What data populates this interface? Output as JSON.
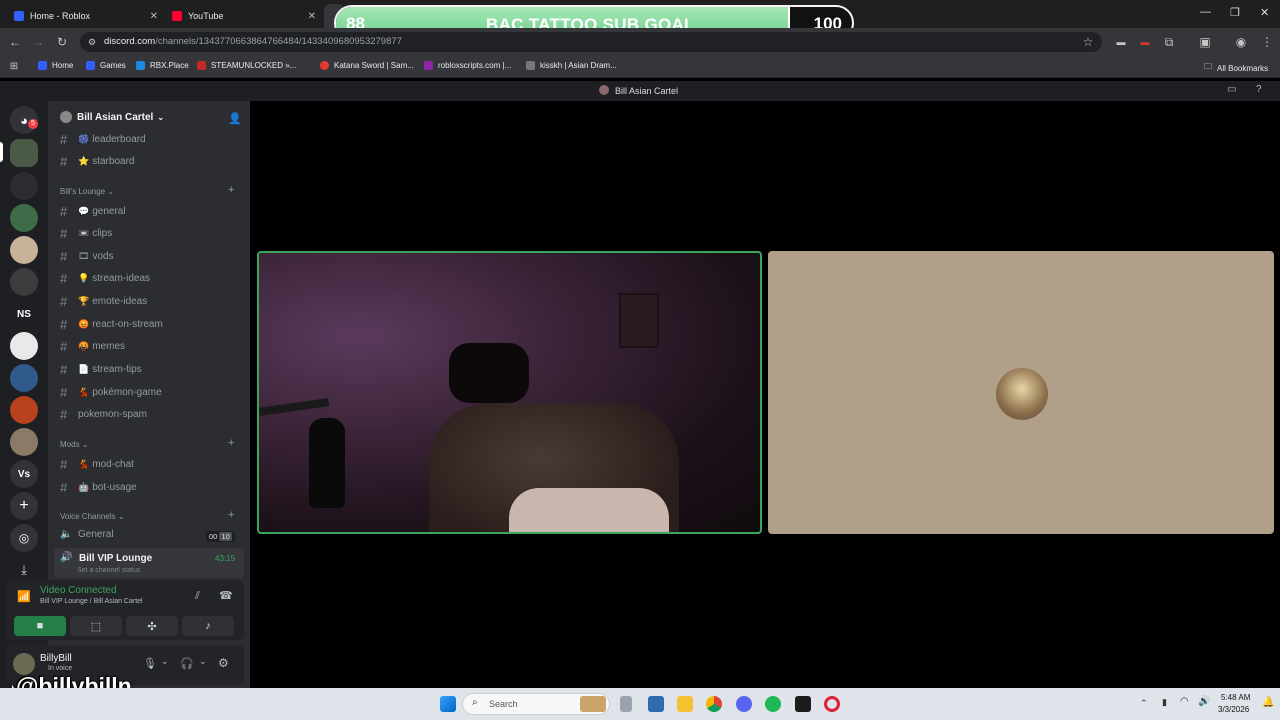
{
  "browser": {
    "tabs": [
      {
        "title": "Home - Roblox",
        "favicon_color": "#335fff"
      },
      {
        "title": "YouTube",
        "favicon_color": "#ff0033"
      },
      {
        "title": "",
        "favicon_color": "#5865f2"
      }
    ],
    "url_host": "discord.com",
    "url_path": "/channels/1343770663864766484/1433409680953279877",
    "bookmarks": [
      "Home",
      "Games",
      "RBX.Place",
      "STEAMUNLOCKED »...",
      "Katana Sword | Sam...",
      "robloxscripts.com |...",
      "kisskh | Asian Dram..."
    ],
    "all_bookmarks": "All Bookmarks"
  },
  "sub_goal": {
    "current": "88",
    "title": "BAC TATTOO SUB GOAL",
    "target": "100",
    "progress": 0.88
  },
  "discord": {
    "window_title": "Bill Asian Cartel",
    "server_name": "Bill Asian Cartel",
    "rail_badge": "5",
    "rail_texts": [
      "NS",
      "Vs"
    ],
    "channels_top": [
      {
        "emoji": "🎆",
        "name": "leaderboard"
      },
      {
        "emoji": "⭐",
        "name": "starboard"
      }
    ],
    "category_lounge": "Bill's Lounge",
    "channels_lounge": [
      {
        "emoji": "💬",
        "name": "general"
      },
      {
        "emoji": "📼",
        "name": "clips"
      },
      {
        "emoji": "🎞",
        "name": "vods"
      },
      {
        "emoji": "💡",
        "name": "stream-ideas"
      },
      {
        "emoji": "🏆",
        "name": "emote-ideas"
      },
      {
        "emoji": "😡",
        "name": "react-on-stream"
      },
      {
        "emoji": "🤬",
        "name": "memes"
      },
      {
        "emoji": "📄",
        "name": "stream-tips"
      },
      {
        "emoji": "💃",
        "name": "pokémon-game"
      },
      {
        "emoji": "",
        "name": "pokemon-spam"
      }
    ],
    "category_mods": "Mods",
    "channels_mods": [
      {
        "emoji": "💃",
        "name": "mod-chat"
      },
      {
        "emoji": "🤖",
        "name": "bot-usage"
      }
    ],
    "category_voice": "Voice Channels",
    "voice_general": {
      "name": "General",
      "count_a": "00",
      "count_b": "10"
    },
    "voice_vip": {
      "name": "Bill VIP Lounge",
      "timer": "43:15",
      "status_placeholder": "Set a channel status"
    },
    "voice_panel": {
      "status": "Video Connected",
      "location": "Bill VIP Lounge / Bill Asian Cartel"
    },
    "user": {
      "name": "BillyBill",
      "status": "In voice"
    }
  },
  "watermark": "@billybilln",
  "taskbar": {
    "search_placeholder": "Search",
    "time": "5:48 AM",
    "date": "3/3/2026"
  },
  "colors": {
    "discord_green": "#3ba55d",
    "goal_green": "#6bd08c",
    "sidebar_bg": "#2b2d31",
    "rail_bg": "#1e1f22"
  }
}
